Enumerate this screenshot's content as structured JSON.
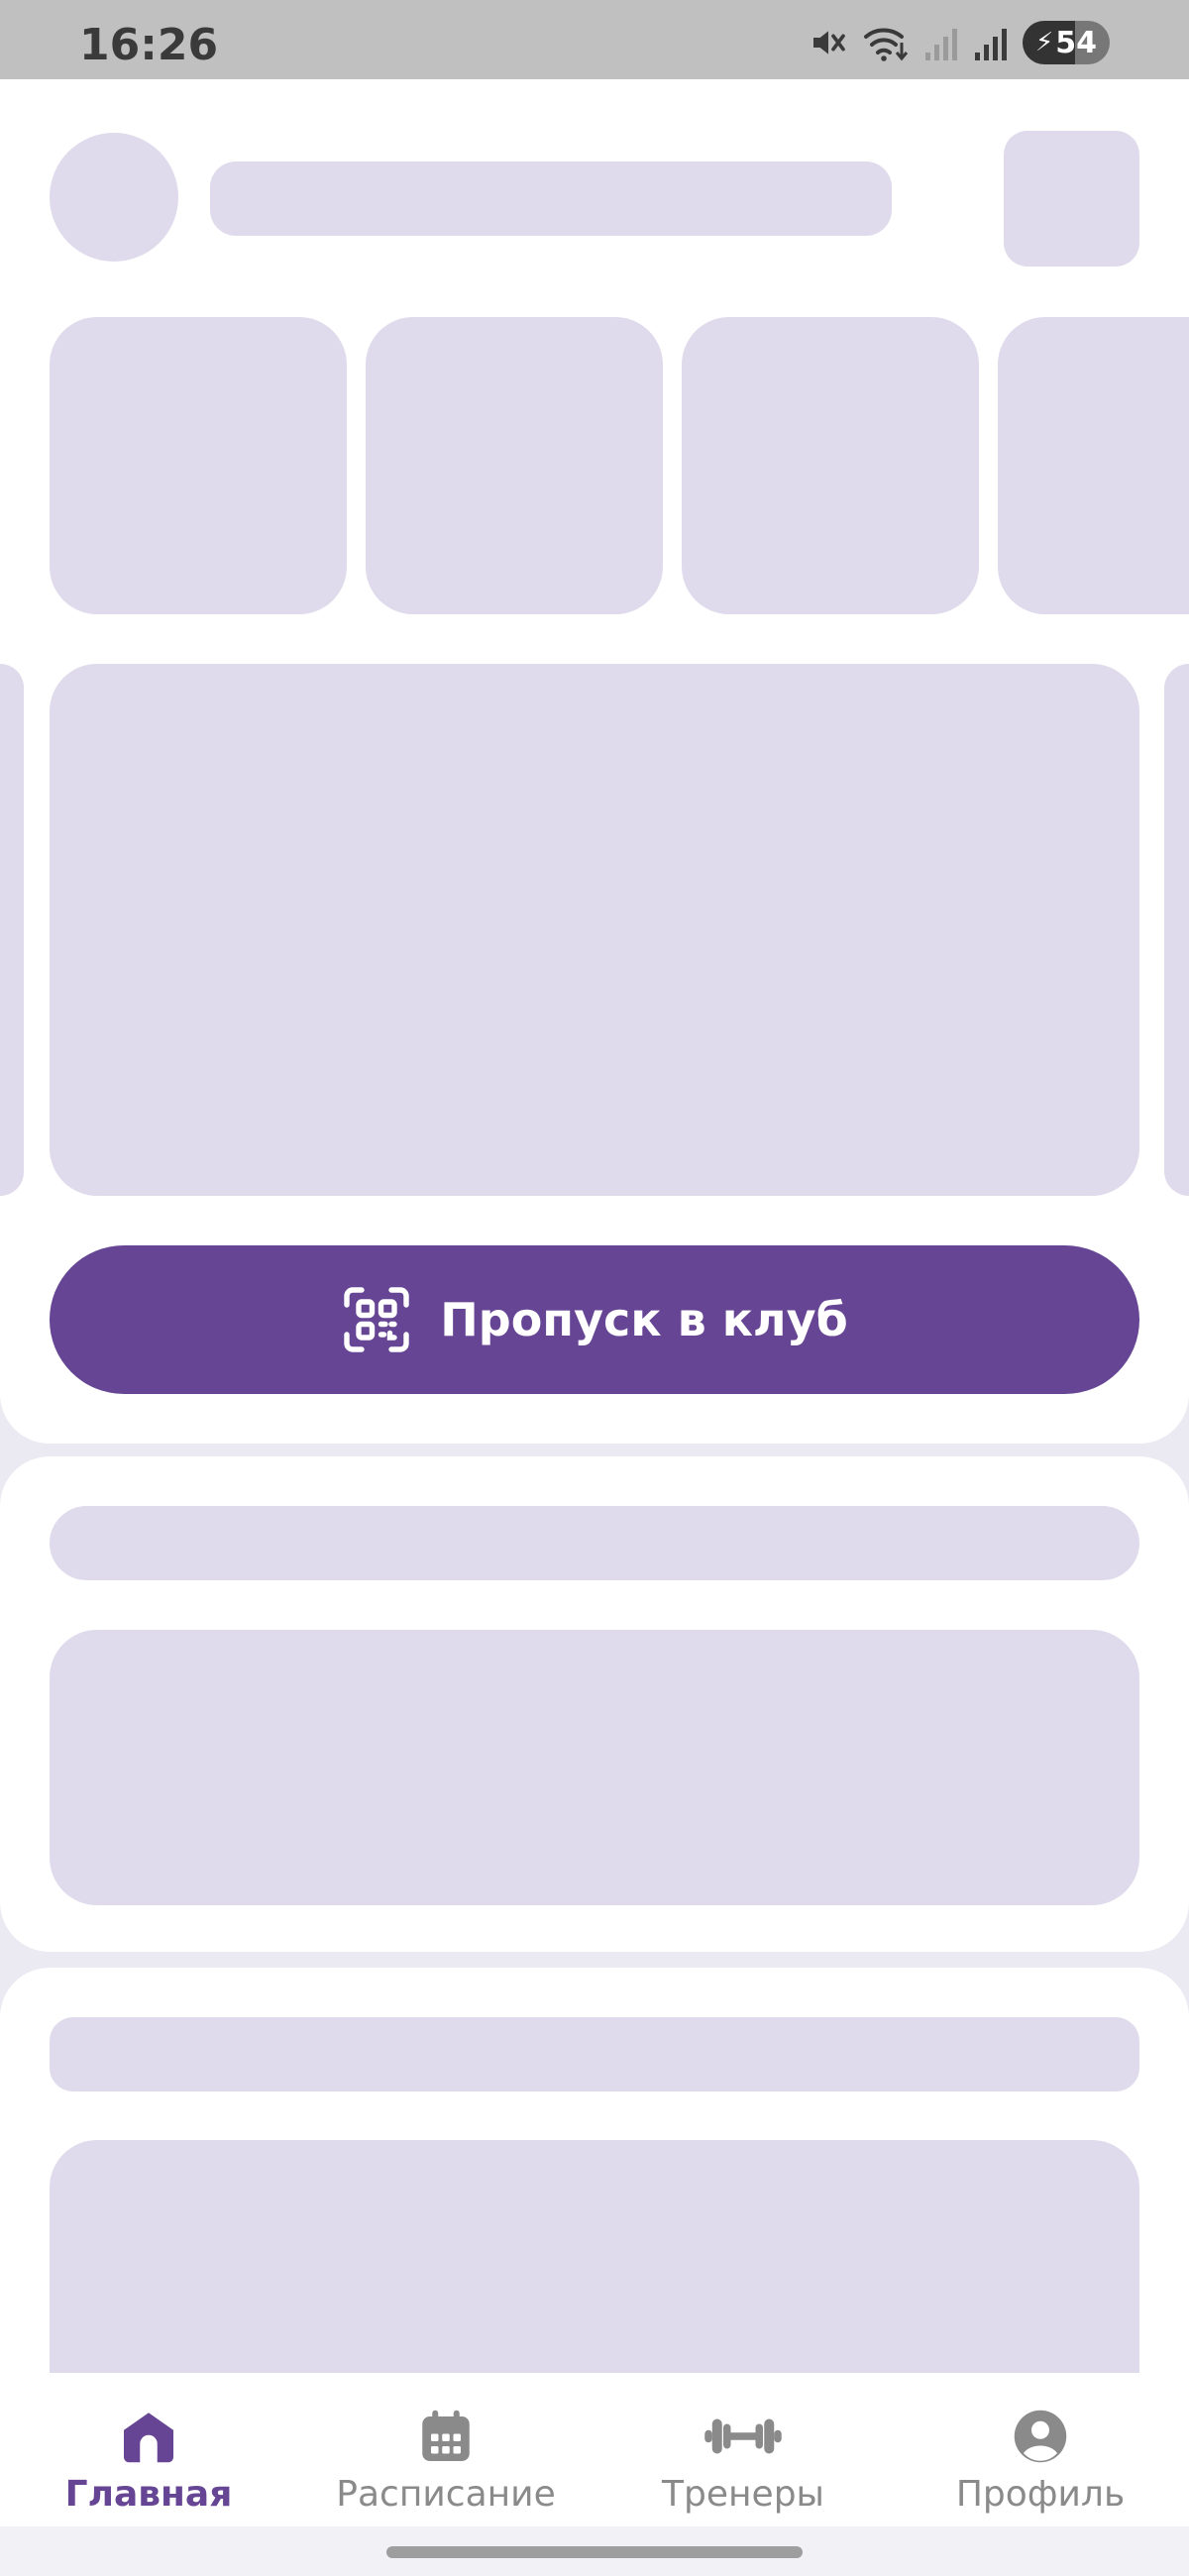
{
  "status_bar": {
    "time": "16:26",
    "battery": "54",
    "icons": [
      "mute-icon",
      "wifi-icon",
      "signal-weak-icon",
      "signal-icon",
      "battery-icon"
    ]
  },
  "pass_button": {
    "label": "Пропуск в клуб",
    "icon": "qr-scan-icon"
  },
  "tab_bar": {
    "active": "home",
    "tabs": [
      {
        "id": "home",
        "label": "Главная",
        "icon": "home-icon"
      },
      {
        "id": "schedule",
        "label": "Расписание",
        "icon": "calendar-icon"
      },
      {
        "id": "trainers",
        "label": "Тренеры",
        "icon": "dumbbell-icon"
      },
      {
        "id": "profile",
        "label": "Профиль",
        "icon": "profile-icon"
      }
    ]
  },
  "colors": {
    "accent": "#654594",
    "skeleton": "#dfdbec",
    "inactive_tab": "#8a8a8a",
    "background": "#ebe9f1"
  }
}
